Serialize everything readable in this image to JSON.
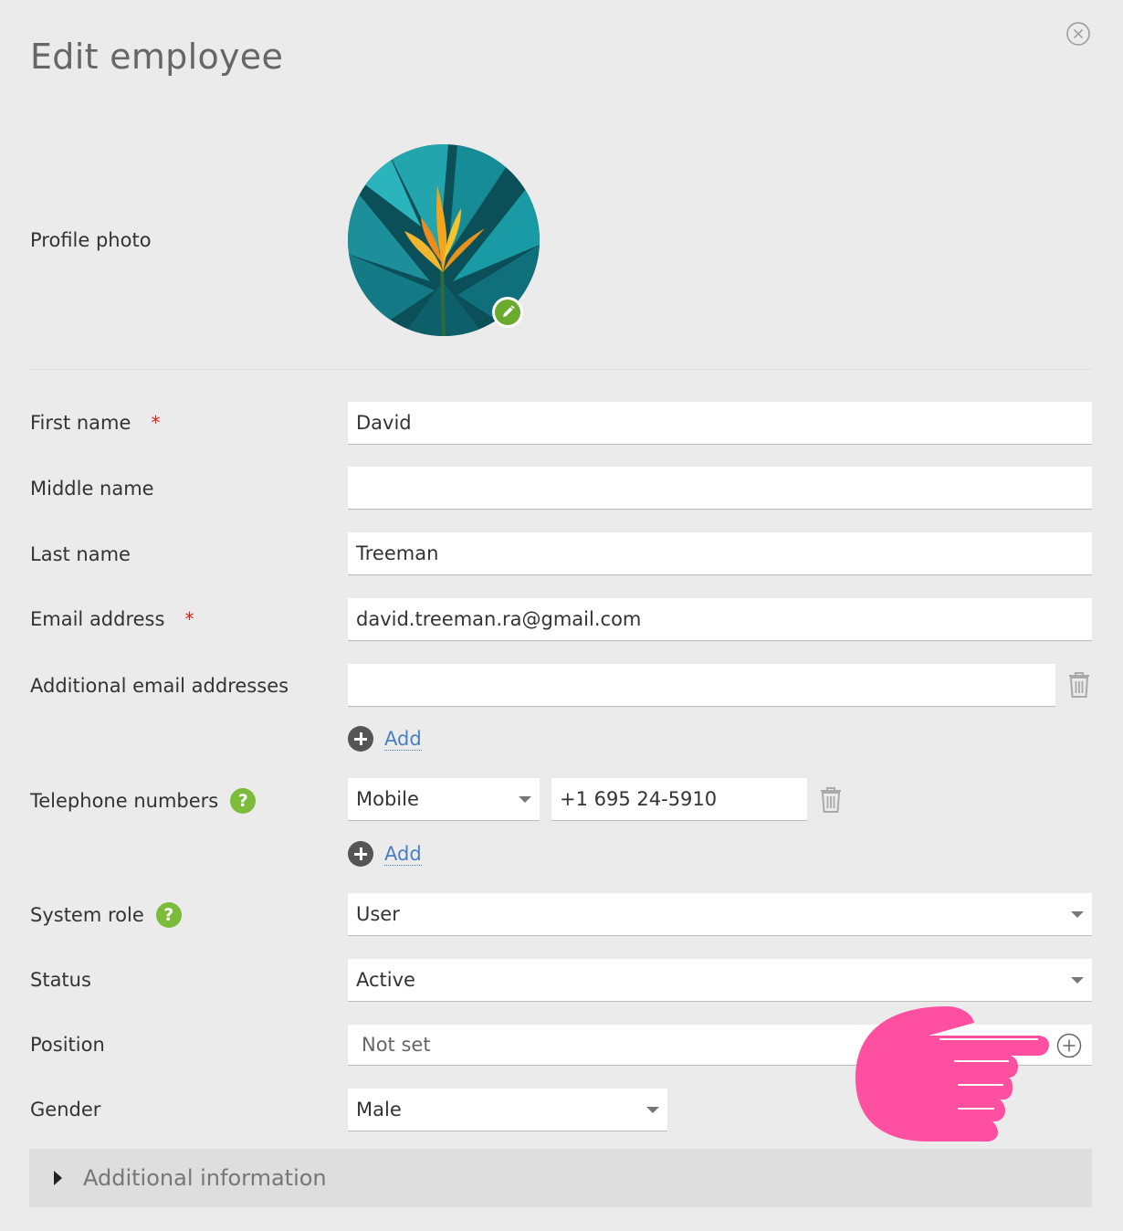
{
  "dialog": {
    "title": "Edit employee"
  },
  "profile_photo": {
    "label": "Profile photo"
  },
  "fields": {
    "first_name": {
      "label": "First name",
      "required_mark": "*",
      "value": "David"
    },
    "middle_name": {
      "label": "Middle name",
      "value": ""
    },
    "last_name": {
      "label": "Last name",
      "value": "Treeman"
    },
    "email": {
      "label": "Email address",
      "required_mark": "*",
      "value": "david.treeman.ra@gmail.com"
    },
    "additional_emails": {
      "label": "Additional email addresses",
      "value": "",
      "add_label": "Add"
    },
    "telephone": {
      "label": "Telephone numbers",
      "help": "?",
      "type_selected": "Mobile",
      "number": "+1 695 24-5910",
      "add_label": "Add"
    },
    "system_role": {
      "label": "System role",
      "help": "?",
      "selected": "User"
    },
    "status": {
      "label": "Status",
      "selected": "Active"
    },
    "position": {
      "label": "Position",
      "placeholder": "Not set"
    },
    "gender": {
      "label": "Gender",
      "selected": "Male"
    }
  },
  "additional_info": {
    "label": "Additional information"
  },
  "colors": {
    "background": "#ebebeb",
    "accent_green": "#7cbc3b",
    "link_blue": "#4b7fc1",
    "required_red": "#e0201d",
    "pointer_pink": "#ff4fa0"
  },
  "icons": [
    "close-icon",
    "pencil-icon",
    "trash-icon",
    "plus-circle-icon",
    "help-icon",
    "caret-down-icon",
    "pointing-hand-icon",
    "triangle-right-icon"
  ]
}
